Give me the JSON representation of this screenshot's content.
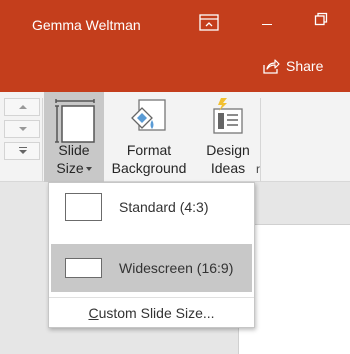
{
  "titlebar": {
    "user_name": "Gemma Weltman",
    "share_label": "Share",
    "colors": {
      "background": "#c43e1c",
      "text": "#ffffff"
    },
    "icons": [
      "ribbon-display-options-icon",
      "minimize-icon",
      "restore-icon",
      "share-icon"
    ]
  },
  "ribbon": {
    "slide_size": {
      "line1": "Slide",
      "line2": "Size",
      "icon": "slide-size-icon"
    },
    "format_background": {
      "line1": "Format",
      "line2": "Background",
      "icon": "format-background-icon"
    },
    "design_ideas": {
      "line1": "Design",
      "line2": "Ideas",
      "icon": "design-ideas-icon"
    },
    "group_label_tail": "r"
  },
  "dropdown": {
    "options": [
      {
        "label": "Standard (4:3)",
        "selected": false
      },
      {
        "label": "Widescreen (16:9)",
        "selected": true
      }
    ],
    "custom": {
      "accel": "C",
      "rest": "ustom Slide Size..."
    },
    "colors": {
      "selected_background": "#c8c8c8"
    }
  }
}
